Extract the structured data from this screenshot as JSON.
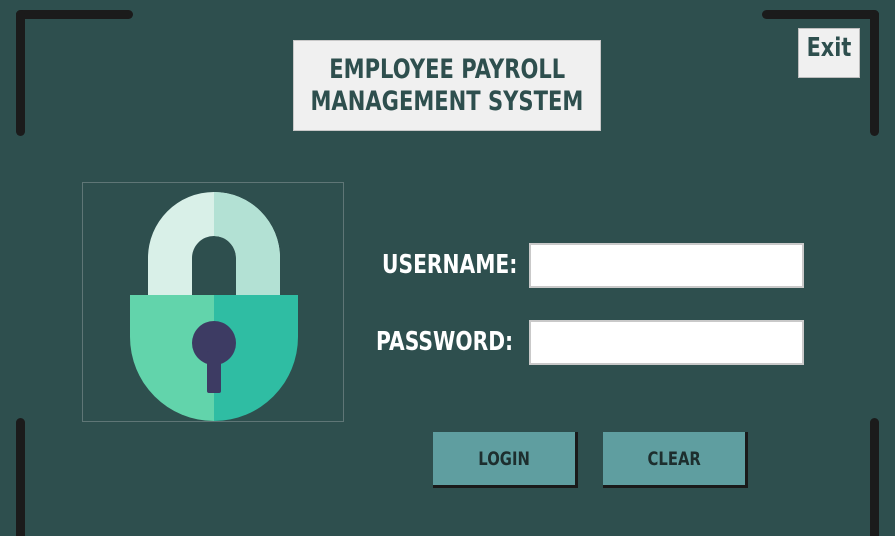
{
  "window": {
    "title_line1": "EMPLOYEE  PAYROLL",
    "title_line2": "MANAGEMENT SYSTEM",
    "exit_label": "Exit"
  },
  "form": {
    "username_label": "USERNAME:",
    "password_label": "PASSWORD:",
    "username_value": "",
    "password_value": ""
  },
  "buttons": {
    "login_label": "LOGIN",
    "clear_label": "CLEAR"
  },
  "icons": {
    "lock": "padlock-icon",
    "keyhole": "keyhole-icon"
  },
  "colors": {
    "background": "#2e4f4e",
    "button": "#5f9ea0",
    "title_text": "#2e4f4e",
    "lock_shackle_light": "#d9f0e8",
    "lock_shackle_dark": "#b3e1d4",
    "lock_body_light": "#62d4ab",
    "lock_body_dark": "#2fbda3",
    "keyhole": "#3d3b63"
  }
}
